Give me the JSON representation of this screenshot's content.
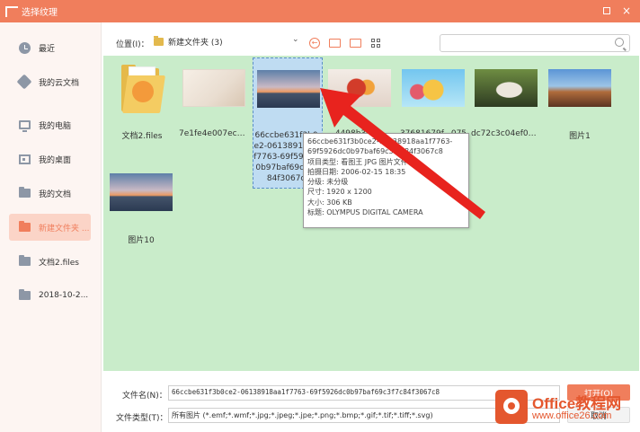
{
  "window": {
    "title": "选择纹理",
    "icon": "app-logo-icon",
    "close_glyph": "×"
  },
  "sidebar": {
    "items": [
      {
        "label": "最近",
        "icon": "clock-icon"
      },
      {
        "label": "我的云文档",
        "icon": "cloud-icon"
      },
      {
        "label": "我的电脑",
        "icon": "computer-icon"
      },
      {
        "label": "我的桌面",
        "icon": "desktop-icon"
      },
      {
        "label": "我的文档",
        "icon": "folder-icon"
      },
      {
        "label": "新建文件夹 ...",
        "icon": "folder-icon",
        "active": true
      },
      {
        "label": "文档2.files",
        "icon": "folder-icon"
      },
      {
        "label": "2018-10-2...",
        "icon": "folder-icon"
      }
    ]
  },
  "toolbar": {
    "location_label": "位置(I)：",
    "path": "新建文件夹 (3)",
    "dropdown_glyph": "⌄",
    "back_glyph": "←",
    "search_placeholder": ""
  },
  "files": [
    {
      "name": "文档2.files",
      "kind": "folder"
    },
    {
      "name": "7e1fe4e007ece...",
      "kind": "image",
      "style": "paper"
    },
    {
      "name": "66ccbe631f3b0ce2-06138918aa1f7763-69f5926dc0b97baf69c3f7c84f3067c8",
      "kind": "image",
      "style": "sunset",
      "selected": true
    },
    {
      "name": "4498b3d4...",
      "kind": "image",
      "style": "fruit"
    },
    {
      "name": "37681679f...075",
      "kind": "image",
      "style": "cartoon"
    },
    {
      "name": "dc72c3c04ef01f...",
      "kind": "image",
      "style": "dog"
    },
    {
      "name": "图片1",
      "kind": "image",
      "style": "mountain"
    },
    {
      "name": "图片10",
      "kind": "image",
      "style": "sunset"
    }
  ],
  "tooltip": {
    "lines": [
      "66ccbe631f3b0ce2-06138918aa1f7763-",
      "69f5926dc0b97baf69c3f7c84f3067c8",
      "项目类型: 看图王 JPG 图片文件",
      "拍摄日期: 2006-02-15 18:35",
      "分级: 未分级",
      "尺寸: 1920 x 1200",
      "大小: 306 KB",
      "标题: OLYMPUS DIGITAL CAMERA"
    ]
  },
  "form": {
    "filename_label": "文件名(N)：",
    "filename_value": "66ccbe631f3b0ce2-06138918aa1f7763-69f5926dc0b97baf69c3f7c84f3067c8",
    "filetype_label": "文件类型(T)：",
    "filetype_value": "所有图片 (*.emf;*.wmf;*.jpg;*.jpeg;*.jpe;*.png;*.bmp;*.gif;*.tif;*.tiff;*.svg)",
    "open_label": "打开(O)",
    "cancel_label": "取消"
  },
  "watermark": {
    "line1": "Office教程网",
    "line2": "www.office26.com"
  },
  "colors": {
    "accent": "#f07e5c",
    "content_bg": "#c9ecca",
    "selection_bg": "#bfdcf2"
  }
}
